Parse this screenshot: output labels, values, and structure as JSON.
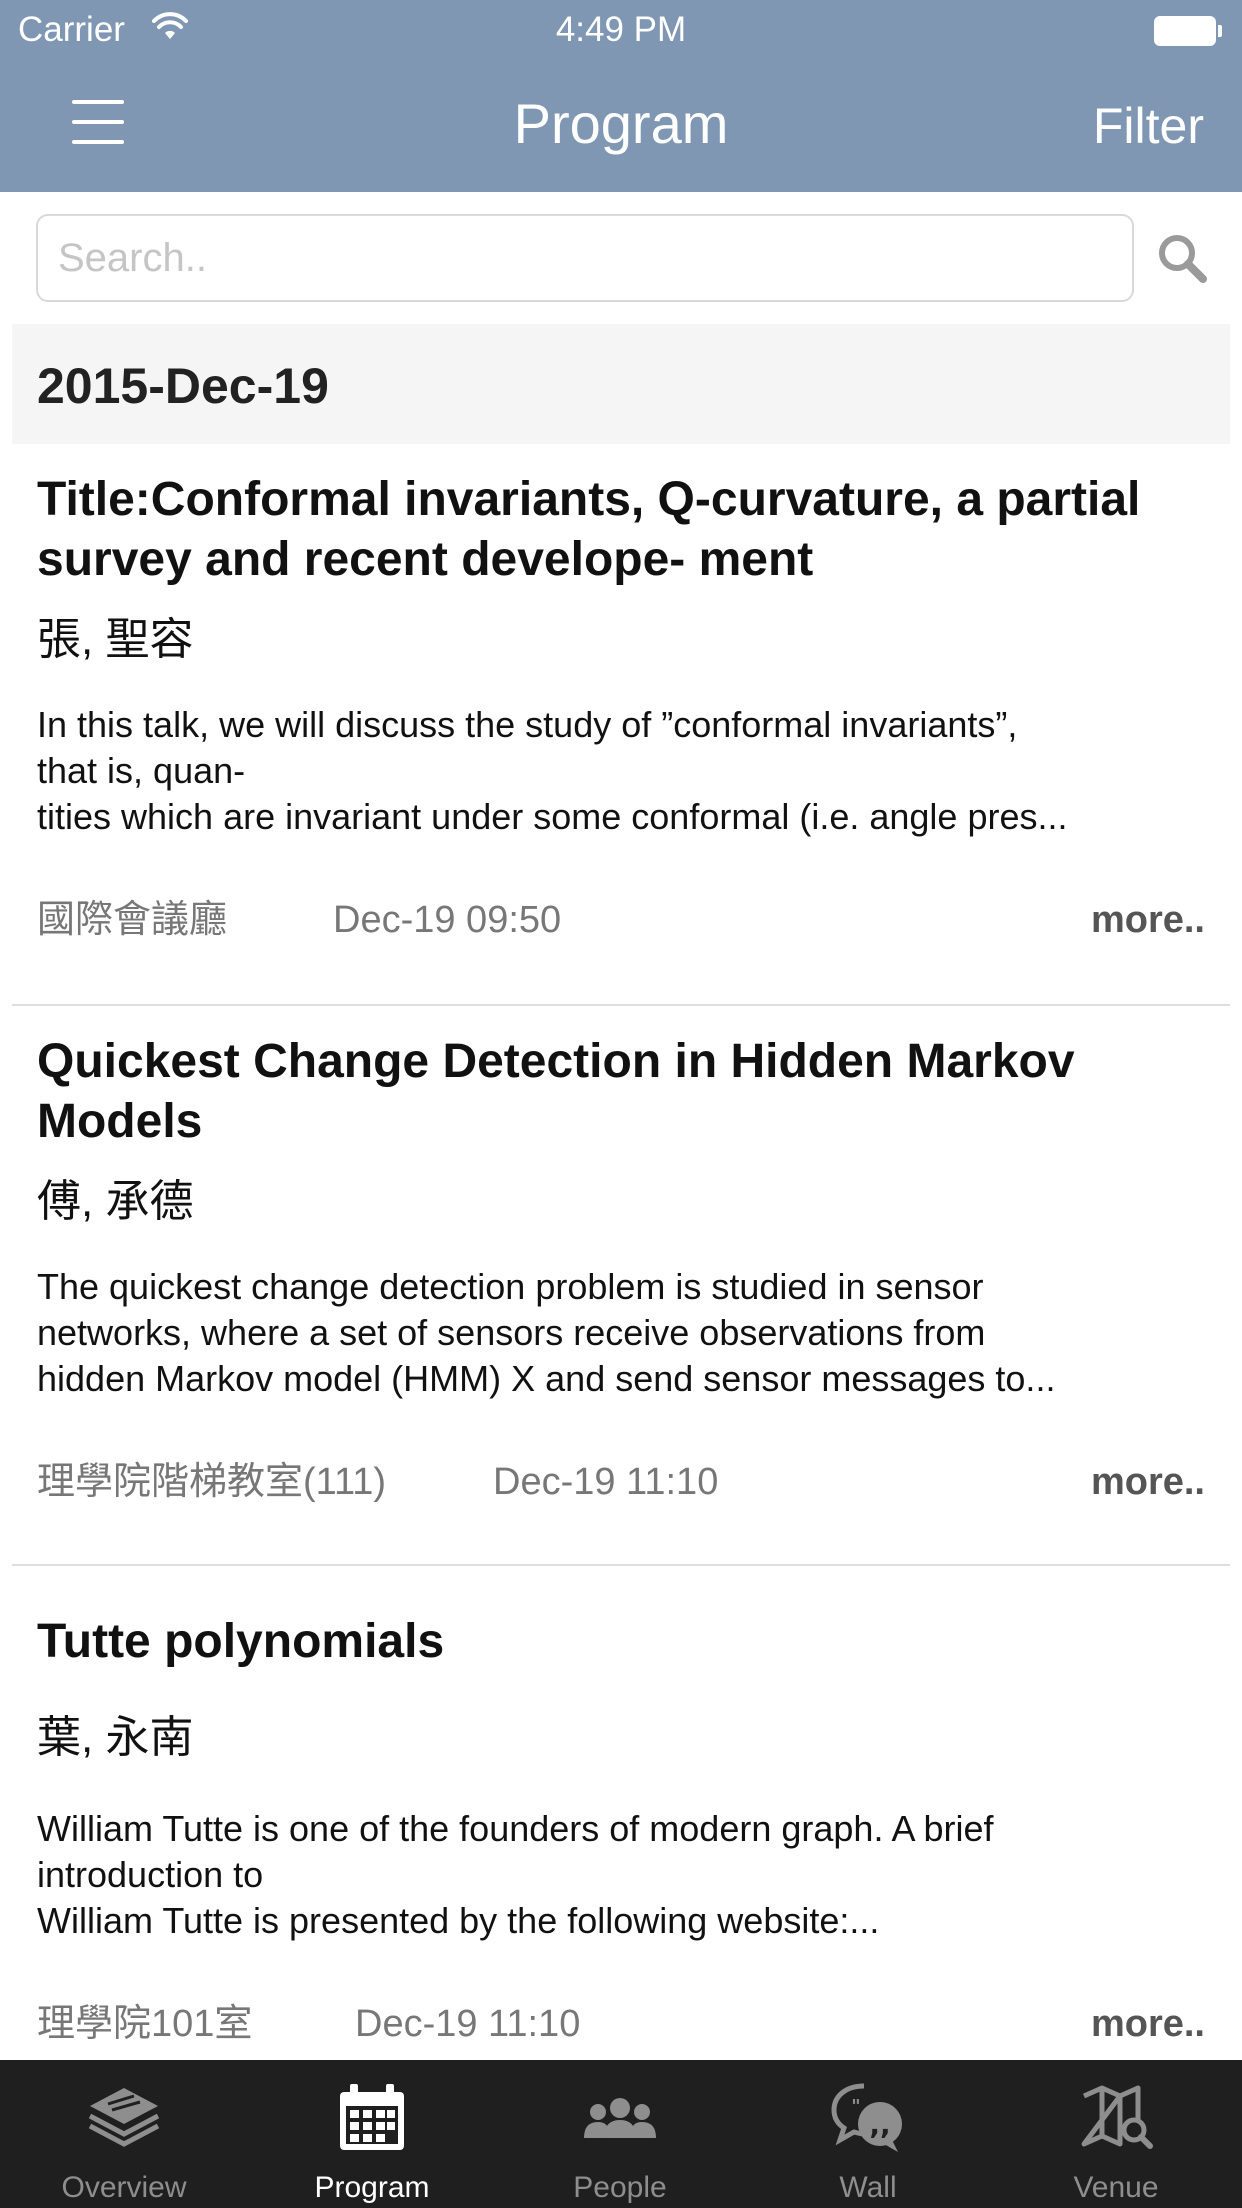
{
  "status_bar": {
    "carrier": "Carrier",
    "time": "4:49 PM"
  },
  "nav": {
    "title": "Program",
    "filter_label": "Filter",
    "menu_icon": "hamburger-menu-icon"
  },
  "search": {
    "placeholder": "Search..",
    "value": "",
    "icon": "search-icon"
  },
  "date_header": "2015-Dec-19",
  "items": [
    {
      "title": "Title:Conformal invariants, Q-curvature, a partial survey and recent develope- ment",
      "speaker": "張, 聖容",
      "abstract_lines": [
        "In this talk, we will discuss the study of ”conformal invariants”,",
        "that is, quan-",
        "tities which are invariant under some conformal (i.e. angle pres..."
      ],
      "room": "國際會議廳",
      "time": "Dec-19 09:50",
      "more": "more.."
    },
    {
      "title": "Quickest Change Detection in Hidden Markov Models",
      "speaker": "傅, 承德",
      "abstract_lines": [
        "The quickest change detection problem is studied in sensor",
        "networks, where a set of sensors receive observations from",
        "hidden Markov model (HMM) X and send sensor messages to..."
      ],
      "room": "理學院階梯教室(111)",
      "time": "Dec-19 11:10",
      "more": "more.."
    },
    {
      "title": "Tutte polynomials",
      "speaker": "葉, 永南",
      "abstract_lines": [
        "William Tutte is one of the founders of modern graph. A brief",
        "introduction to",
        "William Tutte is presented by the following website:..."
      ],
      "room": "理學院101室",
      "time": "Dec-19 11:10",
      "more": "more.."
    }
  ],
  "tabs": [
    {
      "label": "Overview",
      "icon": "overview-layers-icon",
      "active": false
    },
    {
      "label": "Program",
      "icon": "program-calendar-icon",
      "active": true
    },
    {
      "label": "People",
      "icon": "people-group-icon",
      "active": false
    },
    {
      "label": "Wall",
      "icon": "wall-chat-bubble-icon",
      "active": false
    },
    {
      "label": "Venue",
      "icon": "venue-map-search-icon",
      "active": false
    }
  ],
  "colors": {
    "nav_background": "#7f97b3",
    "tab_background": "#1f1f1f",
    "tab_active": "#ffffff",
    "tab_inactive": "#8e8e8e",
    "date_header_background": "#f5f5f5"
  }
}
